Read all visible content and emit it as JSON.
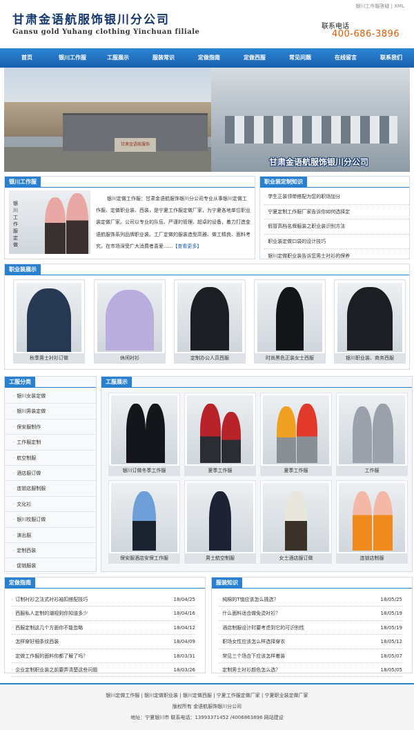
{
  "header": {
    "logo_cn": "甘肃金语航服饰银川分公司",
    "logo_en": "Gansu gold Yuhang clothing Yinchuan filiale",
    "top_link_1": "银川工作服答疑",
    "top_link_sep": "|",
    "top_link_2": "XML",
    "tel_label": "联系电话",
    "tel_number": "400-686-3896"
  },
  "nav": [
    "首页",
    "银川工作服",
    "工服展示",
    "服装常识",
    "定做指南",
    "定做西服",
    "常见问题",
    "在线留言",
    "联系我们"
  ],
  "banner": {
    "title": "甘肃金语航服饰银川分公司",
    "sign_text": "甘肃金语航服饰"
  },
  "about": {
    "tab": "银川工作服",
    "img_label": "银川工作服定做",
    "text": "银川定做工作服：甘肃金语航服饰银川分公司专业从事银川定做工作服、定做职业装、西装，是宁夏工作服定做厂家，为宁夏各地单位职业装定做厂家。公司以专业的队伍、严谨的管理、超卓的设备，着力打造金语航服饰系列品牌职业装。工厂定做的服装造型高雅、做工精良、面料考究，在市场深受广大消费者喜爱......",
    "more": "【查看更多】"
  },
  "knowledge": {
    "tab": "职业装定制知识",
    "items": [
      "学生正装领带搭配为您的职场加分",
      "宁夏定制工作服厂家告诉你如何选择定",
      "假冒高档名牌服装之职业装识别方法",
      "职业装定做口袋的设计技巧",
      "银川定做职业装告诉您男士衬衫的保养"
    ]
  },
  "gallery": {
    "tab": "职业装展示",
    "items": [
      "秋季男士衬衫订做",
      "休闲衬衫",
      "定制办公人员西服",
      "时尚黑色正装女士西服",
      "银川职业装、商务西服"
    ]
  },
  "categories": {
    "tab": "工服分类",
    "items": [
      "银川女装定做",
      "银川男装定做",
      "保安服制作",
      "工作服定制",
      "航空制服",
      "酒店服订做",
      "连锁店服制服",
      "文化衫",
      "银川校服订做",
      "演出服",
      "定制西装",
      "促销服装"
    ]
  },
  "showcase": {
    "tab": "工服展示",
    "items": [
      "银川订做冬季工作服",
      "夏季工作服",
      "夏季工作服",
      "工作服",
      "保安服酒店安保工作服",
      "男士航空制服",
      "女士酒店服订做",
      "连锁店制服"
    ]
  },
  "guide": {
    "tab": "定做指南",
    "items": [
      {
        "t": "订制衬衫之法式衬衫袖扣搭配技巧",
        "d": "18/04/25"
      },
      {
        "t": "西服私人定制的潮规则你知道多少",
        "d": "18/04/16"
      },
      {
        "t": "西服定制这几个方面你不能忽略",
        "d": "18/04/12"
      },
      {
        "t": "怎样穿好细条纹西装",
        "d": "18/04/09"
      },
      {
        "t": "定做工作服的面料你都了解了吗？",
        "d": "18/03/31"
      },
      {
        "t": "企业定制职业装之前要弄清楚这些问题",
        "d": "18/03/26"
      }
    ]
  },
  "clothing": {
    "tab": "服装知识",
    "items": [
      {
        "t": "纯棉的T恤应该怎么挑选？",
        "d": "18/05/25"
      },
      {
        "t": "什么面料适合做免烫衬衫？",
        "d": "18/05/19"
      },
      {
        "t": "酒店制服设计时要考虑到它的可识别性",
        "d": "18/05/19"
      },
      {
        "t": "职场女性应该怎么样选择穿衣",
        "d": "18/05/12"
      },
      {
        "t": "常见三个场合下应该怎样着装",
        "d": "18/05/07"
      },
      {
        "t": "定制男士衬衫颜色怎么选？",
        "d": "18/05/05"
      }
    ]
  },
  "footer": {
    "links": "银川定做工作服 | 银川定做职业装 | 银川定做西服 | 宁夏工作服定做厂家 | 宁夏职业装定做厂家",
    "copyright": "版权所有 金语航服饰银川分公司",
    "address": "地址：宁夏银川市 联系电话：13993371452 /4006863896 网站建设"
  },
  "colors": {
    "nav": "#1a60b0",
    "accent": "#2a80d0",
    "phone": "#e05a00"
  }
}
